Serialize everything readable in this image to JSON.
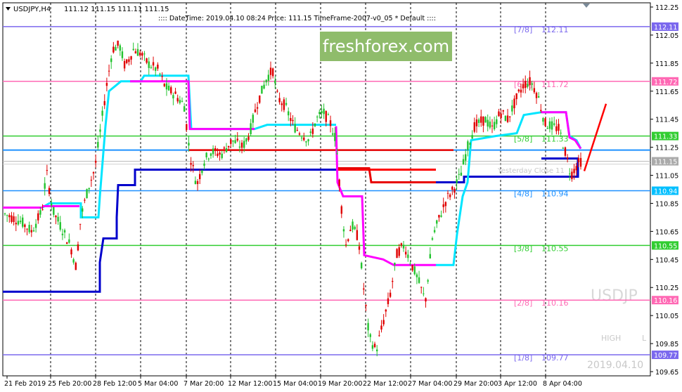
{
  "header": {
    "symbol": "USDJPY,H4",
    "ohlc": "111.12 111.15 111.11 111.15",
    "info": ":::: DateTime: 2019.04.10 08:24   Price: 111.15   TimeFrame-2007-v0_05   *  Default  ::::"
  },
  "watermark": {
    "brand": "freshforex.com",
    "symbol": "USDJP",
    "date": "2019.04.10",
    "high": "HIGH",
    "low": "L"
  },
  "chart_data": {
    "type": "candlestick",
    "y_range": [
      109.62,
      112.28
    ],
    "y_ticks": [
      "112.25",
      "112.05",
      "111.85",
      "111.65",
      "111.45",
      "111.25",
      "111.05",
      "110.85",
      "110.65",
      "110.45",
      "110.25",
      "110.05",
      "109.85",
      "109.65"
    ],
    "x_ticks": [
      "21 Feb 2019",
      "25 Feb 20:00",
      "28 Feb 12:00",
      "5 Mar 04:00",
      "7 Mar 20:00",
      "12 Mar 12:00",
      "15 Mar 04:00",
      "19 Mar 20:00",
      "22 Mar 12:00",
      "27 Mar 04:00",
      "29 Mar 20:00",
      "3 Apr 12:00",
      "8 Apr 04:00"
    ],
    "murrey_levels": [
      {
        "label": "[7/8]",
        "value": "112.11",
        "color": "#7b68ee"
      },
      {
        "label": "[6/8]",
        "value": "111.72",
        "color": "#ff69b4"
      },
      {
        "label": "[5/8]",
        "value": "111.33",
        "color": "#32cd32"
      },
      {
        "label": "[4/8]",
        "value": "110.94",
        "color": "#1e90ff"
      },
      {
        "label": "[3/8]",
        "value": "110.55",
        "color": "#32cd32"
      },
      {
        "label": "[2/8]",
        "value": "110.16",
        "color": "#ff69b4"
      },
      {
        "label": "[1/8]",
        "value": "109.77",
        "color": "#7b68ee"
      }
    ],
    "price_tags": [
      {
        "value": "112.11",
        "color": "#7b68ee"
      },
      {
        "value": "111.72",
        "color": "#ff69b4"
      },
      {
        "value": "111.33",
        "color": "#32cd32"
      },
      {
        "value": "111.15",
        "color": "#aaaaaa"
      },
      {
        "value": "110.94",
        "color": "#00bfff"
      },
      {
        "value": "110.55",
        "color": "#32cd32"
      },
      {
        "value": "110.16",
        "color": "#ff69b4"
      },
      {
        "value": "109.77",
        "color": "#7b68ee"
      }
    ],
    "yesterday_close_label": "Yesterday Close 11",
    "current_price": "111.15"
  }
}
